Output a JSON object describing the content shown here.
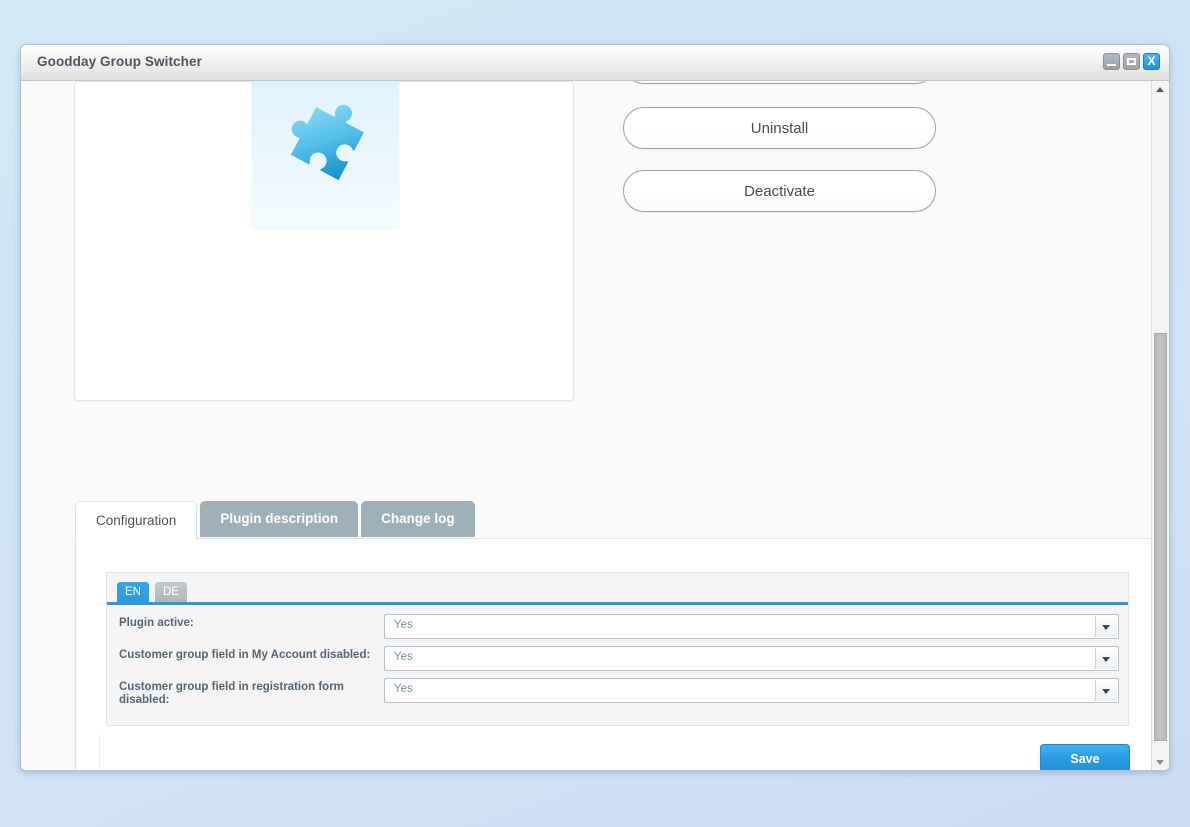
{
  "window": {
    "title": "Goodday Group Switcher",
    "controls": [
      {
        "name": "minimize",
        "label": ""
      },
      {
        "name": "maximize",
        "label": ""
      },
      {
        "name": "close",
        "label": "X"
      }
    ]
  },
  "plugin": {
    "icon": "puzzle-piece-icon"
  },
  "actions": {
    "cut_off_button": "",
    "uninstall": "Uninstall",
    "deactivate": "Deactivate"
  },
  "tabs": [
    {
      "label": "Configuration",
      "active": true
    },
    {
      "label": "Plugin description",
      "active": false
    },
    {
      "label": "Change log",
      "active": false
    }
  ],
  "language_tabs": [
    {
      "label": "EN",
      "active": true
    },
    {
      "label": "DE",
      "active": false
    }
  ],
  "form": {
    "rows": [
      {
        "label": "Plugin active:",
        "value": "Yes"
      },
      {
        "label": "Customer group field in My Account disabled:",
        "value": "Yes"
      },
      {
        "label": "Customer group field in registration form disabled:",
        "value": "Yes"
      }
    ],
    "save_label": "Save"
  },
  "colors": {
    "accent_blue": "#2b9ae0",
    "tab_inactive": "#9fb0b8",
    "label_text": "#566573",
    "value_text": "#7b8fa3"
  }
}
